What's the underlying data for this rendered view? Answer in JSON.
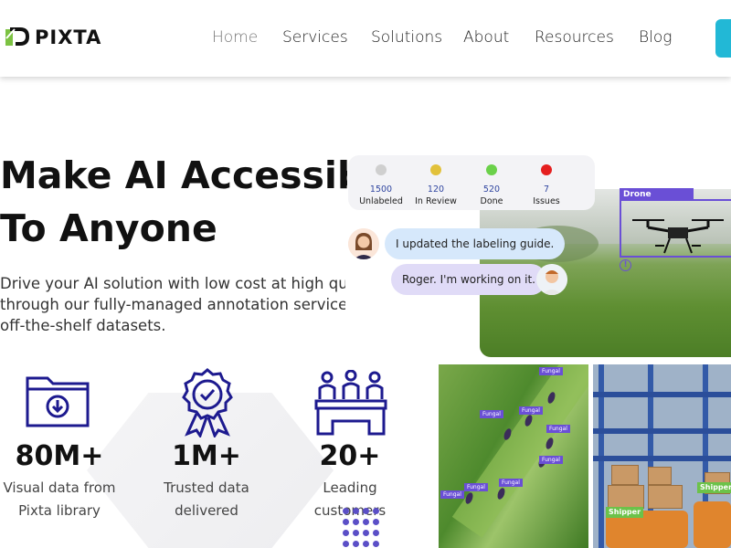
{
  "header": {
    "logo_text": "PIXTA",
    "nav": [
      {
        "label": "Home",
        "active": true
      },
      {
        "label": "Services",
        "active": false
      },
      {
        "label": "Solutions",
        "active": false
      },
      {
        "label": "About",
        "active": false
      },
      {
        "label": "Resources",
        "active": false
      },
      {
        "label": "Blog",
        "active": false
      }
    ],
    "cta_color": "#22b8d6"
  },
  "hero": {
    "title_line1": "Make AI Accessible",
    "title_line2": "To Anyone",
    "subtitle_line1": "Drive your AI solution with low cost at high qualit",
    "subtitle_line2": "through our fully-managed annotation service",
    "subtitle_line3": "off-the-shelf datasets."
  },
  "stats": [
    {
      "value": "80M+",
      "label_line1": "Visual data from",
      "label_line2": "Pixta library",
      "icon": "folder-download-icon"
    },
    {
      "value": "1M+",
      "label_line1": "Trusted data",
      "label_line2": "delivered",
      "icon": "award-badge-icon"
    },
    {
      "value": "20+",
      "label_line1": "Leading",
      "label_line2": "customers",
      "icon": "meeting-people-icon"
    }
  ],
  "status_card": [
    {
      "count": "1500",
      "name": "Unlabeled",
      "color": "#cfcfcf"
    },
    {
      "count": "120",
      "name": "In Review",
      "color": "#e2c13a"
    },
    {
      "count": "520",
      "name": "Done",
      "color": "#6bd14a"
    },
    {
      "count": "7",
      "name": "Issues",
      "color": "#e51f1f"
    }
  ],
  "chat": {
    "message1": "I updated the labeling guide.",
    "message2": "Roger. I'm working on it."
  },
  "annotations": {
    "drone_label": "Drone",
    "leaf_label": "Fungal",
    "shipper_label": "Shipper"
  },
  "colors": {
    "accent": "#6a4fd6",
    "navy_icon": "#1d1a8f"
  }
}
